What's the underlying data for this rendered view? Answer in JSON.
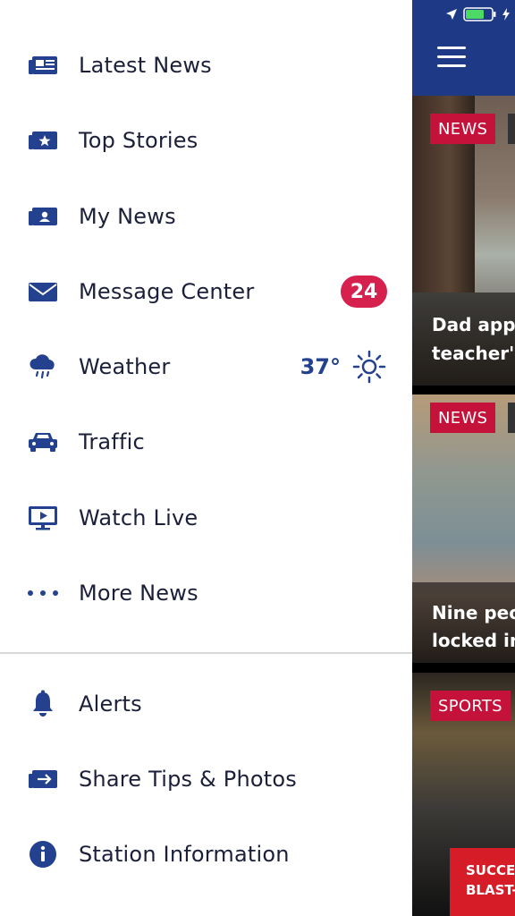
{
  "menu": {
    "items": [
      {
        "label": "Latest News",
        "icon": "newspaper-icon"
      },
      {
        "label": "Top Stories",
        "icon": "star-folder-icon"
      },
      {
        "label": "My News",
        "icon": "person-folder-icon"
      },
      {
        "label": "Message Center",
        "icon": "envelope-icon",
        "badge": "24"
      },
      {
        "label": "Weather",
        "icon": "cloud-rain-icon",
        "temp": "37°",
        "condition_icon": "sun-icon"
      },
      {
        "label": "Traffic",
        "icon": "car-icon"
      },
      {
        "label": "Watch Live",
        "icon": "tv-play-icon"
      },
      {
        "label": "More News",
        "icon": "ellipsis-icon"
      }
    ],
    "secondary": [
      {
        "label": "Alerts",
        "icon": "bell-icon"
      },
      {
        "label": "Share Tips & Photos",
        "icon": "share-arrow-icon"
      },
      {
        "label": "Station Information",
        "icon": "info-icon"
      }
    ]
  },
  "colors": {
    "accent": "#24418f",
    "badge": "#d6204e",
    "header": "#1e3a86",
    "tag": "#c4123a"
  },
  "feed": {
    "cards": [
      {
        "tag": "NEWS",
        "headline_lines": [
          "Dad app",
          "teacher's"
        ]
      },
      {
        "tag": "NEWS",
        "headline_lines": [
          "Nine peo",
          "locked in"
        ]
      },
      {
        "tag": "SPORTS",
        "banner_lines": [
          "SUCCES",
          "BLAST-"
        ]
      }
    ]
  }
}
